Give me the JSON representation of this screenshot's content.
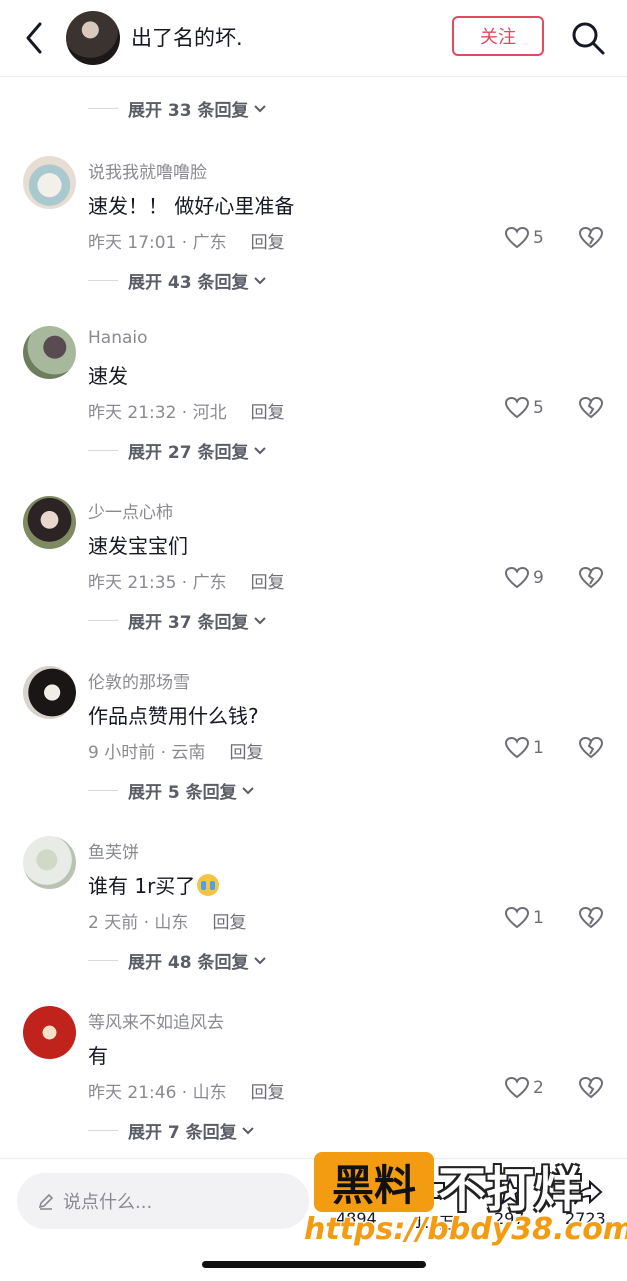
{
  "header": {
    "name": "出了名的坏.",
    "follow_label": "关注",
    "icons": [
      "back-arrow-icon",
      "search-icon"
    ]
  },
  "prev_replies": {
    "label": "展开 33 条回复"
  },
  "comments": [
    {
      "name": "说我我就噜噜脸",
      "text": "速发！！ 做好心里准备",
      "time_loc": "昨天 17:01 · 广东",
      "reply": "回复",
      "likes": "5",
      "more": "展开 43 条回复"
    },
    {
      "name": "Hanaio",
      "text": "速发",
      "time_loc": "昨天 21:32 · 河北",
      "reply": "回复",
      "likes": "5",
      "more": "展开 27 条回复"
    },
    {
      "name": "少一点心柿",
      "text": "速发宝宝们",
      "time_loc": "昨天 21:35 · 广东",
      "reply": "回复",
      "likes": "9",
      "more": "展开 37 条回复"
    },
    {
      "name": "伦敦的那场雪",
      "text": "作品点赞用什么钱?",
      "time_loc": "9 小时前 · 云南",
      "reply": "回复",
      "likes": "1",
      "more": "展开 5 条回复"
    },
    {
      "name": "鱼芙饼",
      "text": "谁有 1r买了",
      "time_loc": "2 天前 · 山东",
      "reply": "回复",
      "likes": "1",
      "more": "展开 48 条回复"
    },
    {
      "name": "等风来不如追风去",
      "text": "有",
      "time_loc": "昨天 21:46 · 山东",
      "reply": "回复",
      "likes": "2",
      "more": "展开 7 条回复"
    }
  ],
  "bottombar": {
    "placeholder": "说点什么...",
    "stats": [
      "4894",
      "1.1万",
      "297",
      "2723"
    ]
  },
  "watermark": {
    "box": "黑料",
    "text": "不打烊",
    "url": "https://bbdy38.com"
  },
  "colors": {
    "accent": "#e24a5f",
    "watermark": "#f39c12"
  }
}
